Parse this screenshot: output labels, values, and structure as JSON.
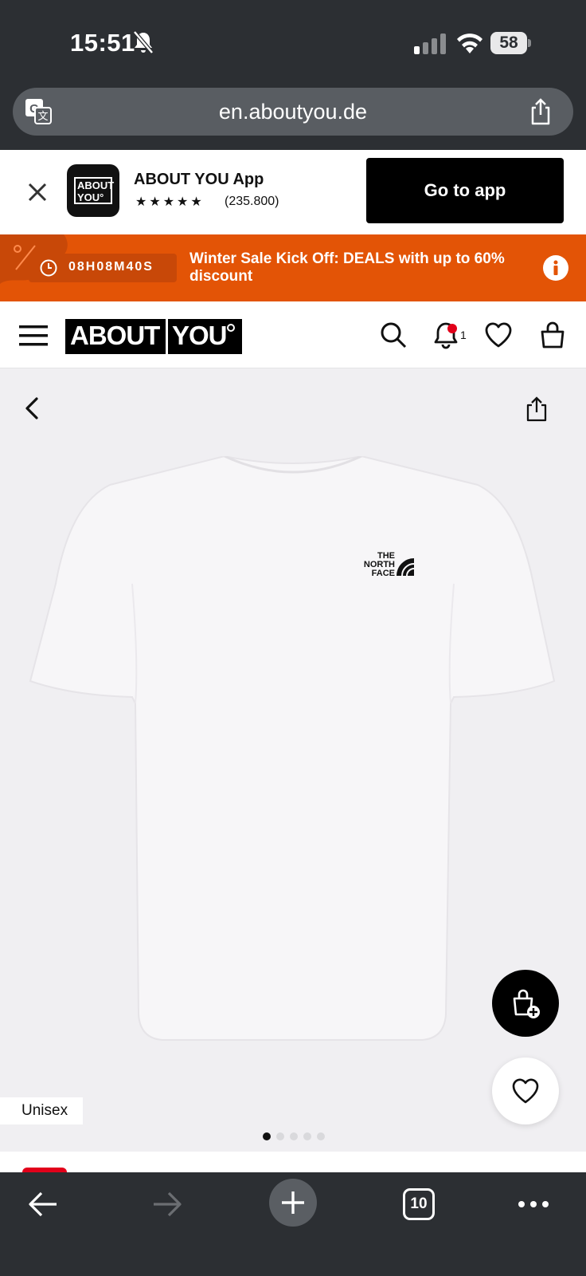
{
  "status_bar": {
    "time": "15:51",
    "battery": "58"
  },
  "browser": {
    "url": "en.aboutyou.de",
    "tab_count": "10"
  },
  "app_banner": {
    "app_name": "ABOUT YOU App",
    "stars": "★★★★★",
    "rating_count": "(235.800)",
    "cta_label": "Go to app",
    "logo_text_1": "ABOUT",
    "logo_text_2": "YOU°"
  },
  "promo": {
    "timer": "08H08M40S",
    "text": "Winter Sale Kick Off: DEALS with up to 60% discount"
  },
  "header": {
    "brand_left": "ABOUT",
    "brand_right": "YOU",
    "notification_count": "1"
  },
  "product": {
    "tag": "Unisex",
    "gallery": {
      "total_images": 5,
      "active_index": 0
    },
    "logo_lines": [
      "THE",
      "NORTH",
      "FACE"
    ]
  },
  "colors": {
    "promo_bg": "#e35406",
    "badge_red": "#e2001a",
    "product_bg": "#f0eff2",
    "chrome_dark": "#2c2f33"
  },
  "icons": [
    "bell-off-icon",
    "signal-icon",
    "wifi-icon",
    "battery-icon",
    "translate-icon",
    "share-icon",
    "close-icon",
    "clock-icon",
    "info-icon",
    "menu-icon",
    "search-icon",
    "bell-icon",
    "heart-icon",
    "bag-icon",
    "chevron-left-icon",
    "add-to-bag-icon",
    "arrow-left-icon",
    "arrow-right-icon",
    "plus-icon",
    "tabs-icon",
    "more-icon"
  ]
}
